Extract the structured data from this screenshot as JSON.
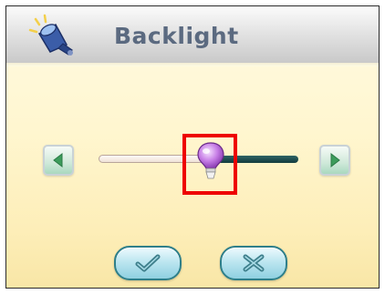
{
  "window": {
    "title": "Backlight",
    "title_icon": "lamp-icon"
  },
  "slider": {
    "label": "",
    "level": 0.55,
    "decrease_icon": "triangle-left-icon",
    "increase_icon": "triangle-right-icon",
    "thumb_icon": "light-bulb-icon"
  },
  "actions": {
    "ok_icon": "checkmark-icon",
    "cancel_icon": "x-icon"
  },
  "colors": {
    "highlight": "#ee0000",
    "title_text": "#5b6a80",
    "track_filled": "#123c3e",
    "button_border": "#2e7f8a"
  }
}
